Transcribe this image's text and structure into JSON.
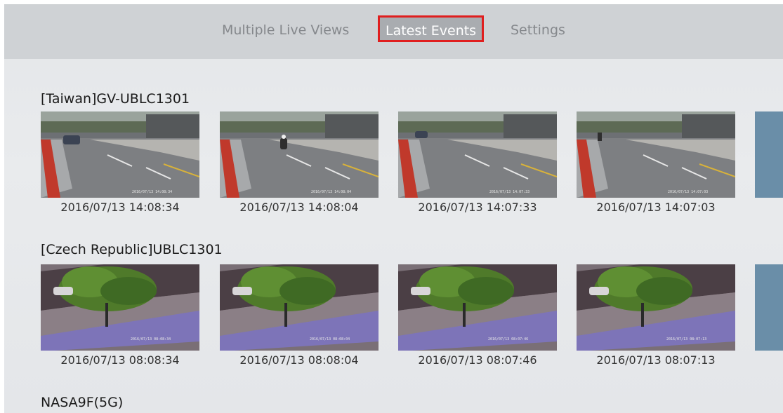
{
  "tabs": {
    "multiple_live_views": "Multiple Live Views",
    "latest_events": "Latest Events",
    "settings": "Settings"
  },
  "sections": [
    {
      "title": "[Taiwan]GV-UBLC1301",
      "events": [
        {
          "timestamp": "2016/07/13 14:08:34",
          "osd": "2016/07/13 14:08:34"
        },
        {
          "timestamp": "2016/07/13 14:08:04",
          "osd": "2016/07/13 14:08:04"
        },
        {
          "timestamp": "2016/07/13 14:07:33",
          "osd": "2016/07/13 14:07:33"
        },
        {
          "timestamp": "2016/07/13 14:07:03",
          "osd": "2016/07/13 14:07:03"
        }
      ]
    },
    {
      "title": "[Czech Republic]UBLC1301",
      "events": [
        {
          "timestamp": "2016/07/13 08:08:34",
          "osd": "2016/07/13 08:08:34"
        },
        {
          "timestamp": "2016/07/13 08:08:04",
          "osd": "2016/07/13 08:08:04"
        },
        {
          "timestamp": "2016/07/13 08:07:46",
          "osd": "2016/07/13 08:07:46"
        },
        {
          "timestamp": "2016/07/13 08:07:13",
          "osd": "2016/07/13 08:07:13"
        }
      ]
    },
    {
      "title": "NASA9F(5G)",
      "events": []
    }
  ],
  "colors": {
    "selection_border": "#e01e1e",
    "partial_tile": "#6a8ea8"
  }
}
